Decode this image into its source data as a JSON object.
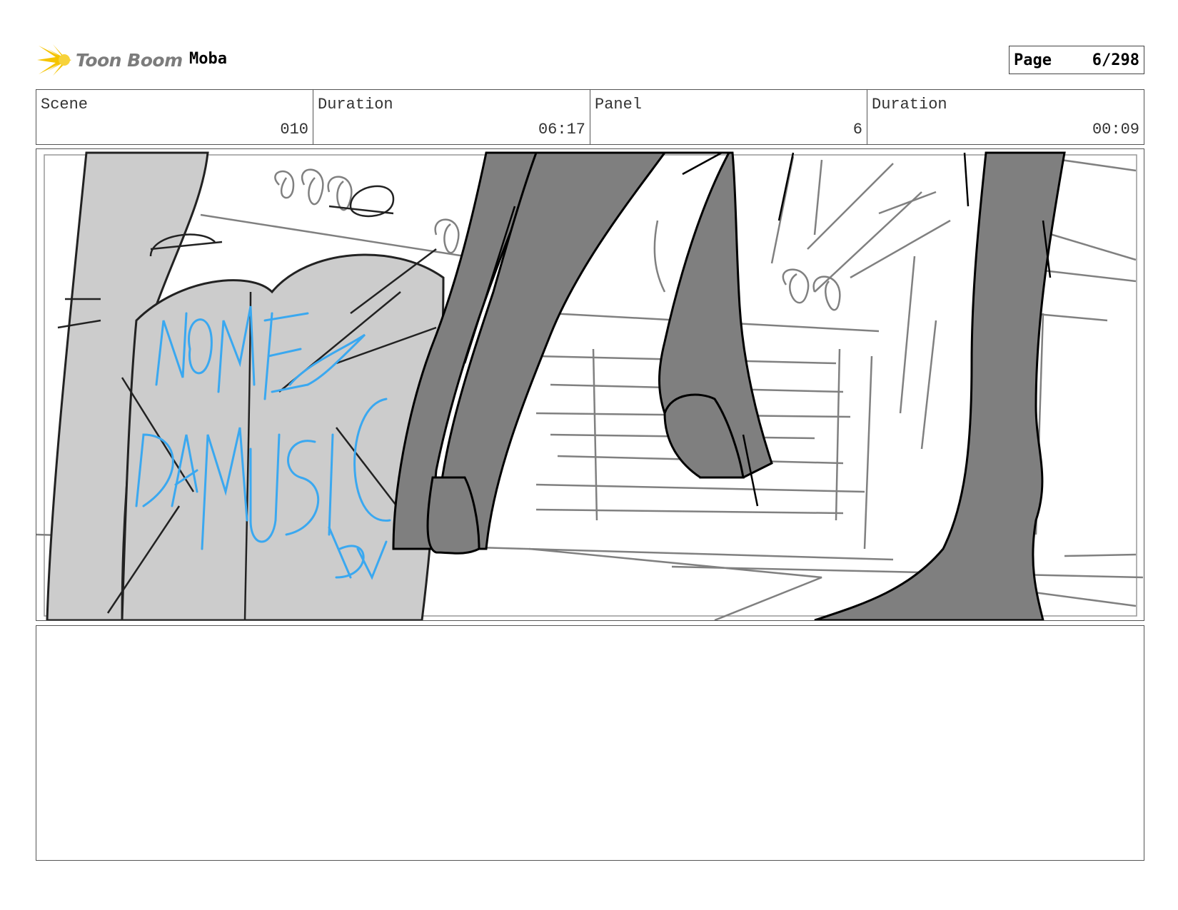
{
  "header": {
    "brand": "Toon Boom",
    "project": "Moba",
    "page_label": "Page",
    "page_value": "6/298"
  },
  "info": {
    "scene_label": "Scene",
    "scene_value": "010",
    "scene_duration_label": "Duration",
    "scene_duration_value": "06:17",
    "panel_label": "Panel",
    "panel_value": "6",
    "panel_duration_label": "Duration",
    "panel_duration_value": "00:09"
  },
  "panel": {
    "graffiti_text": "NOME DA MUSICA BY"
  },
  "colors": {
    "sketch_line": "#222222",
    "sketch_light": "#808080",
    "fill_light": "#cccccc",
    "fill_dark": "#7f7f7f",
    "graffiti": "#3aa8f0",
    "logo_accent": "#f5c400"
  }
}
